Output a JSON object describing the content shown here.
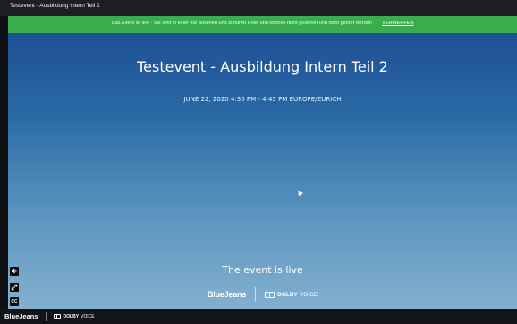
{
  "window": {
    "title": "Testevent - Ausbildung Intern Teil 2"
  },
  "banner": {
    "message": "Das Event ist live · Sie sind in einer nur ansehen und zuhören Rolle und können nicht gesehen und nicht gehört werden",
    "dismiss_label": "VERWERFEN",
    "color": "#3aad4e"
  },
  "event": {
    "title": "Testevent - Ausbildung Intern Teil 2",
    "datetime": "JUNE 22, 2020 4:30 PM - 4:45 PM EUROPE/ZURICH",
    "status": "The event is live"
  },
  "branding": {
    "bluejeans": "BlueJeans",
    "dolby_strong": "DOLBY",
    "dolby_light": "VOICE"
  },
  "controls": {
    "volume_icon": "speaker-icon",
    "fullscreen_icon": "expand-icon",
    "captions_label": "CC"
  },
  "colors": {
    "gradient_top": "#1e4f94",
    "gradient_bottom": "#84b0cf"
  }
}
